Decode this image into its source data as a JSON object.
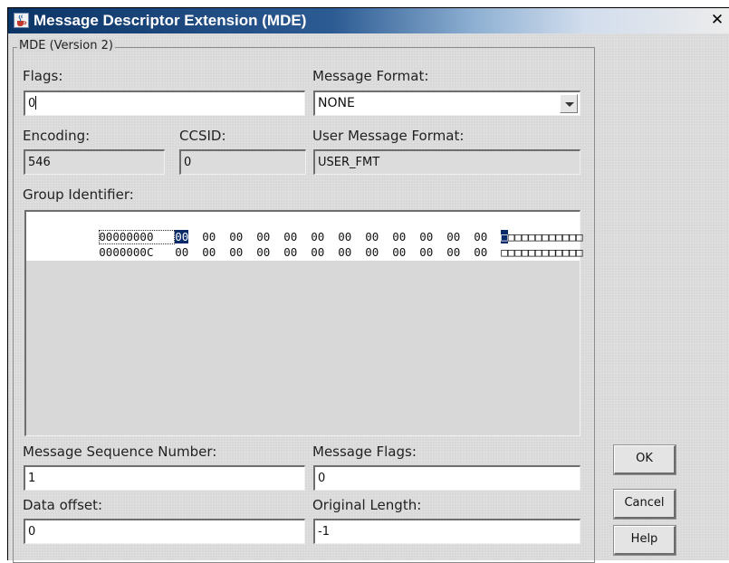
{
  "window": {
    "title": "Message Descriptor Extension (MDE)",
    "close_label": "✕",
    "close_icon": "close-icon",
    "app_icon": "java-cup-icon"
  },
  "group": {
    "title": "MDE (Version 2)"
  },
  "flags": {
    "label": "Flags:",
    "value": "0"
  },
  "message_format": {
    "label": "Message Format:",
    "value": "NONE"
  },
  "encoding": {
    "label": "Encoding:",
    "value": "546"
  },
  "ccsid": {
    "label": "CCSID:",
    "value": "0"
  },
  "user_message_format": {
    "label": "User Message Format:",
    "value": "USER_FMT"
  },
  "group_identifier": {
    "label": "Group Identifier:",
    "rows": [
      {
        "address": "00000000",
        "bytes": [
          "00",
          "00",
          "00",
          "00",
          "00",
          "00",
          "00",
          "00",
          "00",
          "00",
          "00",
          "00"
        ],
        "chars": "□□□□□□□□□□□□"
      },
      {
        "address": "0000000C",
        "bytes": [
          "00",
          "00",
          "00",
          "00",
          "00",
          "00",
          "00",
          "00",
          "00",
          "00",
          "00",
          "00"
        ],
        "chars": "□□□□□□□□□□□□"
      }
    ]
  },
  "message_sequence_number": {
    "label": "Message Sequence Number:",
    "value": "1"
  },
  "message_flags": {
    "label": "Message Flags:",
    "value": "0"
  },
  "data_offset": {
    "label": "Data offset:",
    "value": "0"
  },
  "original_length": {
    "label": "Original Length:",
    "value": "-1"
  },
  "buttons": {
    "ok": "OK",
    "cancel": "Cancel",
    "help": "Help"
  },
  "colors": {
    "title_bar_start": "#0b3466",
    "selection": "#0a2a6a",
    "panel": "#d8d8d8"
  }
}
